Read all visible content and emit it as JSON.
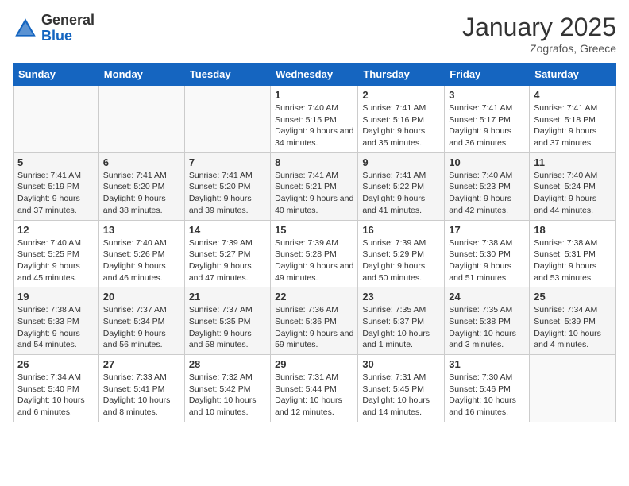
{
  "header": {
    "logo_general": "General",
    "logo_blue": "Blue",
    "main_title": "January 2025",
    "subtitle": "Zografos, Greece"
  },
  "weekdays": [
    "Sunday",
    "Monday",
    "Tuesday",
    "Wednesday",
    "Thursday",
    "Friday",
    "Saturday"
  ],
  "weeks": [
    [
      {
        "day": "",
        "info": ""
      },
      {
        "day": "",
        "info": ""
      },
      {
        "day": "",
        "info": ""
      },
      {
        "day": "1",
        "info": "Sunrise: 7:40 AM\nSunset: 5:15 PM\nDaylight: 9 hours and 34 minutes."
      },
      {
        "day": "2",
        "info": "Sunrise: 7:41 AM\nSunset: 5:16 PM\nDaylight: 9 hours and 35 minutes."
      },
      {
        "day": "3",
        "info": "Sunrise: 7:41 AM\nSunset: 5:17 PM\nDaylight: 9 hours and 36 minutes."
      },
      {
        "day": "4",
        "info": "Sunrise: 7:41 AM\nSunset: 5:18 PM\nDaylight: 9 hours and 37 minutes."
      }
    ],
    [
      {
        "day": "5",
        "info": "Sunrise: 7:41 AM\nSunset: 5:19 PM\nDaylight: 9 hours and 37 minutes."
      },
      {
        "day": "6",
        "info": "Sunrise: 7:41 AM\nSunset: 5:20 PM\nDaylight: 9 hours and 38 minutes."
      },
      {
        "day": "7",
        "info": "Sunrise: 7:41 AM\nSunset: 5:20 PM\nDaylight: 9 hours and 39 minutes."
      },
      {
        "day": "8",
        "info": "Sunrise: 7:41 AM\nSunset: 5:21 PM\nDaylight: 9 hours and 40 minutes."
      },
      {
        "day": "9",
        "info": "Sunrise: 7:41 AM\nSunset: 5:22 PM\nDaylight: 9 hours and 41 minutes."
      },
      {
        "day": "10",
        "info": "Sunrise: 7:40 AM\nSunset: 5:23 PM\nDaylight: 9 hours and 42 minutes."
      },
      {
        "day": "11",
        "info": "Sunrise: 7:40 AM\nSunset: 5:24 PM\nDaylight: 9 hours and 44 minutes."
      }
    ],
    [
      {
        "day": "12",
        "info": "Sunrise: 7:40 AM\nSunset: 5:25 PM\nDaylight: 9 hours and 45 minutes."
      },
      {
        "day": "13",
        "info": "Sunrise: 7:40 AM\nSunset: 5:26 PM\nDaylight: 9 hours and 46 minutes."
      },
      {
        "day": "14",
        "info": "Sunrise: 7:39 AM\nSunset: 5:27 PM\nDaylight: 9 hours and 47 minutes."
      },
      {
        "day": "15",
        "info": "Sunrise: 7:39 AM\nSunset: 5:28 PM\nDaylight: 9 hours and 49 minutes."
      },
      {
        "day": "16",
        "info": "Sunrise: 7:39 AM\nSunset: 5:29 PM\nDaylight: 9 hours and 50 minutes."
      },
      {
        "day": "17",
        "info": "Sunrise: 7:38 AM\nSunset: 5:30 PM\nDaylight: 9 hours and 51 minutes."
      },
      {
        "day": "18",
        "info": "Sunrise: 7:38 AM\nSunset: 5:31 PM\nDaylight: 9 hours and 53 minutes."
      }
    ],
    [
      {
        "day": "19",
        "info": "Sunrise: 7:38 AM\nSunset: 5:33 PM\nDaylight: 9 hours and 54 minutes."
      },
      {
        "day": "20",
        "info": "Sunrise: 7:37 AM\nSunset: 5:34 PM\nDaylight: 9 hours and 56 minutes."
      },
      {
        "day": "21",
        "info": "Sunrise: 7:37 AM\nSunset: 5:35 PM\nDaylight: 9 hours and 58 minutes."
      },
      {
        "day": "22",
        "info": "Sunrise: 7:36 AM\nSunset: 5:36 PM\nDaylight: 9 hours and 59 minutes."
      },
      {
        "day": "23",
        "info": "Sunrise: 7:35 AM\nSunset: 5:37 PM\nDaylight: 10 hours and 1 minute."
      },
      {
        "day": "24",
        "info": "Sunrise: 7:35 AM\nSunset: 5:38 PM\nDaylight: 10 hours and 3 minutes."
      },
      {
        "day": "25",
        "info": "Sunrise: 7:34 AM\nSunset: 5:39 PM\nDaylight: 10 hours and 4 minutes."
      }
    ],
    [
      {
        "day": "26",
        "info": "Sunrise: 7:34 AM\nSunset: 5:40 PM\nDaylight: 10 hours and 6 minutes."
      },
      {
        "day": "27",
        "info": "Sunrise: 7:33 AM\nSunset: 5:41 PM\nDaylight: 10 hours and 8 minutes."
      },
      {
        "day": "28",
        "info": "Sunrise: 7:32 AM\nSunset: 5:42 PM\nDaylight: 10 hours and 10 minutes."
      },
      {
        "day": "29",
        "info": "Sunrise: 7:31 AM\nSunset: 5:44 PM\nDaylight: 10 hours and 12 minutes."
      },
      {
        "day": "30",
        "info": "Sunrise: 7:31 AM\nSunset: 5:45 PM\nDaylight: 10 hours and 14 minutes."
      },
      {
        "day": "31",
        "info": "Sunrise: 7:30 AM\nSunset: 5:46 PM\nDaylight: 10 hours and 16 minutes."
      },
      {
        "day": "",
        "info": ""
      }
    ]
  ]
}
